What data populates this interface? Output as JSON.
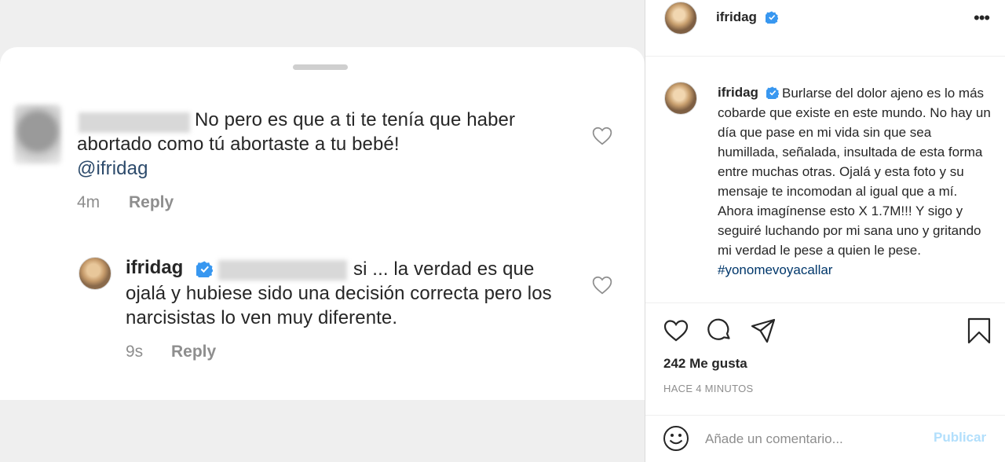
{
  "screenshot": {
    "comment1": {
      "text": "No pero es que a ti te tenía que haber abortado como tú abortaste a tu bebé!",
      "mention": "@ifridag",
      "time": "4m",
      "reply_label": "Reply"
    },
    "comment2": {
      "username": "ifridag",
      "text": "si ... la verdad es que ojalá y hubiese sido una decisión correcta pero los narcisistas lo ven muy diferente.",
      "time": "9s",
      "reply_label": "Reply"
    }
  },
  "post": {
    "username": "ifridag",
    "more_icon": "more-icon",
    "caption": "Burlarse del dolor ajeno es lo más cobarde que existe en este mundo. No hay un día que pase en mi vida sin que sea humillada, señalada, insultada de esta forma entre muchas otras. Ojalá y esta foto y su mensaje te incomodan al igual que a mí. Ahora imagínense esto X 1.7M!!! Y sigo y seguiré luchando por mi sana uno y gritando mi verdad le pese a quien le pese.",
    "hashtag": "#yonomevoyacallar",
    "likes": "242 Me gusta",
    "timestamp": "HACE 4 MINUTOS",
    "comment_placeholder": "Añade un comentario...",
    "publish_label": "Publicar",
    "colors": {
      "verified": "#3897f0",
      "link": "#00376b",
      "publish_disabled": "#b2dffc",
      "muted": "#8e8e8e"
    }
  }
}
